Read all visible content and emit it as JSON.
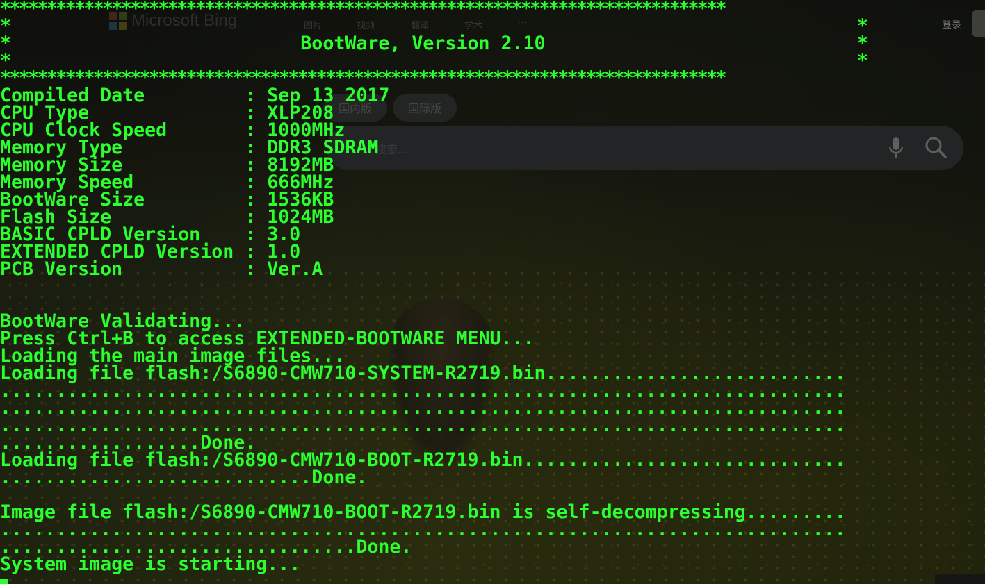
{
  "background": {
    "logo_text": "Microsoft Bing",
    "nav": [
      "图片",
      "视频",
      "翻译",
      "学术",
      "···"
    ],
    "signin": "登录",
    "region_tabs": [
      "国内版",
      "国际版"
    ],
    "search_placeholder": "搜索..."
  },
  "terminal": {
    "banner": {
      "border": "******************************************************************************",
      "blank": "*                                                                            *",
      "title": "*                          BootWare, Version 2.10                            *"
    },
    "info": [
      {
        "label": "Compiled Date         ",
        "value": "Sep 13 2017"
      },
      {
        "label": "CPU Type              ",
        "value": "XLP208"
      },
      {
        "label": "CPU Clock Speed       ",
        "value": "1000MHz"
      },
      {
        "label": "Memory Type           ",
        "value": "DDR3 SDRAM"
      },
      {
        "label": "Memory Size           ",
        "value": "8192MB"
      },
      {
        "label": "Memory Speed          ",
        "value": "666MHz"
      },
      {
        "label": "BootWare Size         ",
        "value": "1536KB"
      },
      {
        "label": "Flash Size            ",
        "value": "1024MB"
      },
      {
        "label": "BASIC CPLD Version    ",
        "value": "3.0"
      },
      {
        "label": "EXTENDED CPLD Version ",
        "value": "1.0"
      },
      {
        "label": "PCB Version           ",
        "value": "Ver.A"
      }
    ],
    "separator": ": ",
    "log": [
      "",
      "",
      "BootWare Validating...",
      "Press Ctrl+B to access EXTENDED-BOOTWARE MENU...",
      "Loading the main image files...",
      "Loading file flash:/S6890-CMW710-SYSTEM-R2719.bin...........................",
      "............................................................................",
      "............................................................................",
      "............................................................................",
      "..................Done.",
      "Loading file flash:/S6890-CMW710-BOOT-R2719.bin.............................",
      "............................Done.",
      "",
      "Image file flash:/S6890-CMW710-BOOT-R2719.bin is self-decompressing.........",
      "............................................................................",
      "................................Done.",
      "System image is starting..."
    ]
  },
  "colors": {
    "terminal_text": "#2bff2e",
    "background": "#0c0d09"
  }
}
